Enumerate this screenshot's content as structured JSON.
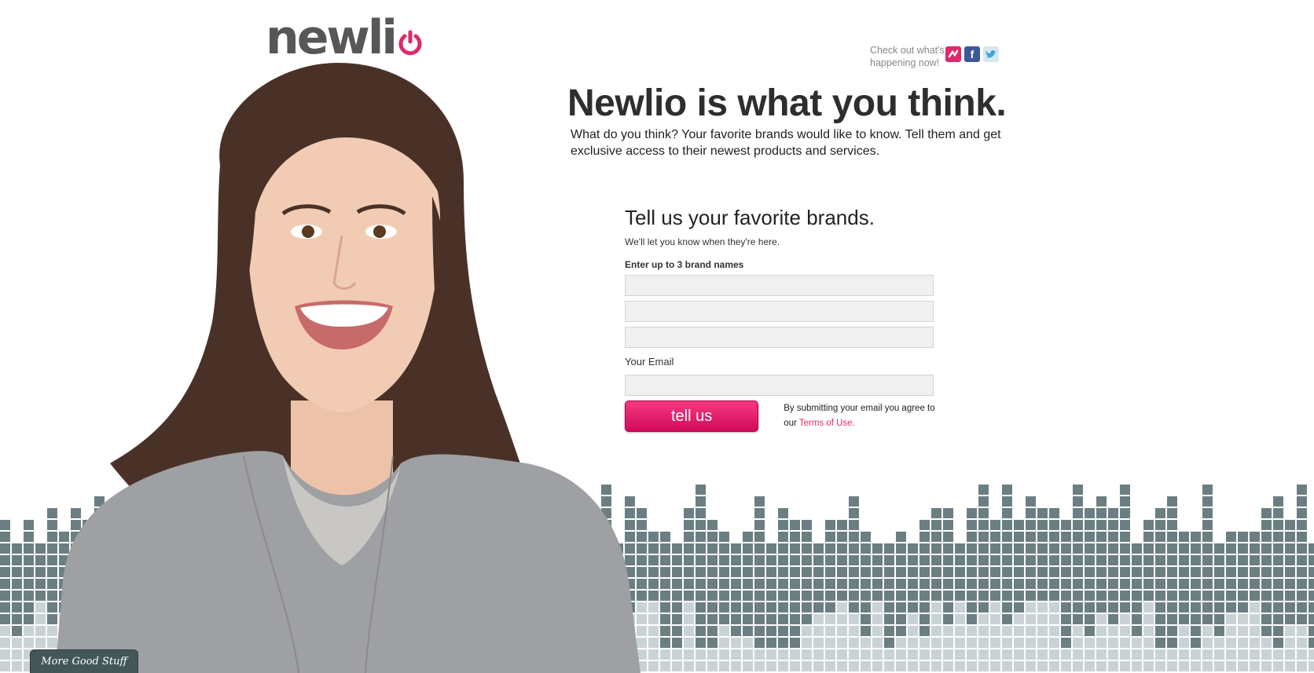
{
  "brand": {
    "logo_text": "newli",
    "accent_color": "#e0286a",
    "logo_color": "#555759"
  },
  "social": {
    "text": "Check out what's happening now!",
    "icons": [
      "newlio-icon",
      "facebook-icon",
      "twitter-icon"
    ]
  },
  "hero": {
    "headline": "Newlio is what you think.",
    "subhead": "What do you think? Your favorite brands would like to know. Tell them and get exclusive access to their newest products and services."
  },
  "form": {
    "title": "Tell us your favorite brands.",
    "subtitle": "We'll let you know when they're here.",
    "brands_label": "Enter up to 3 brand names",
    "brand_fields": [
      "",
      "",
      ""
    ],
    "email_label": "Your Email",
    "email_value": "",
    "submit_label": "tell us",
    "terms_prefix": "By submitting your email you agree to our ",
    "terms_link": "Terms of Use."
  },
  "footer": {
    "more_tab": "More Good Stuff"
  },
  "colors": {
    "equalizer_dark": "#6b7f82",
    "equalizer_light": "#c9d3d5",
    "button": "#e0145e"
  }
}
